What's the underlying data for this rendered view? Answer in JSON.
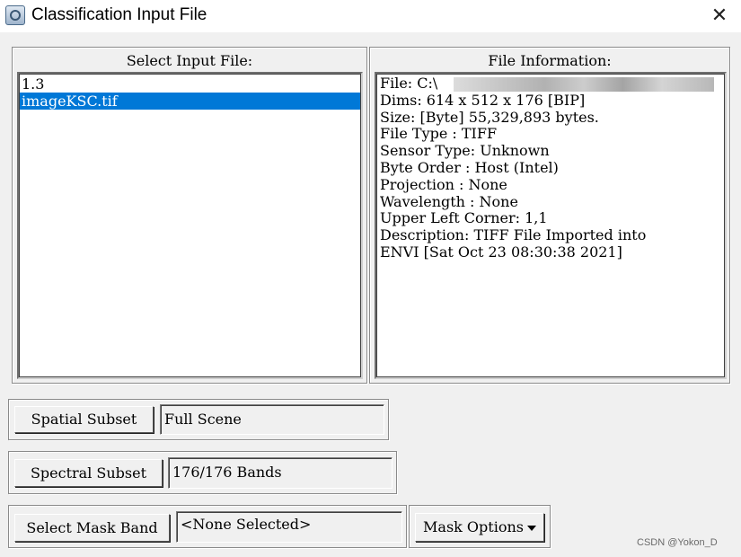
{
  "window": {
    "title": "Classification Input File",
    "close_glyph": "✕",
    "app_icon": "envi-app-icon"
  },
  "select_input": {
    "title": "Select Input File:",
    "items": [
      {
        "label": "1.3",
        "selected": false
      },
      {
        "label": "imageKSC.tif",
        "selected": true
      }
    ],
    "selection_color": "#0078d7"
  },
  "file_info": {
    "title": "File Information:",
    "lines": [
      "File: C:\\",
      "Dims: 614 x 512 x 176 [BIP]",
      "Size: [Byte] 55,329,893 bytes.",
      "File Type  : TIFF",
      "Sensor Type: Unknown",
      "Byte Order : Host (Intel)",
      "Projection : None",
      "Wavelength : None",
      "Upper Left Corner: 1,1",
      "Description: TIFF File Imported into ENVI [Sat Oct 23 08:30:38 2021]"
    ]
  },
  "spatial_subset": {
    "button_label": "Spatial Subset",
    "value": "Full Scene"
  },
  "spectral_subset": {
    "button_label": "Spectral Subset",
    "value": "176/176 Bands"
  },
  "mask": {
    "button_label": "Select Mask Band",
    "value": "<None Selected>",
    "options_label": "Mask Options"
  },
  "watermark": "CSDN @Yokon_D"
}
